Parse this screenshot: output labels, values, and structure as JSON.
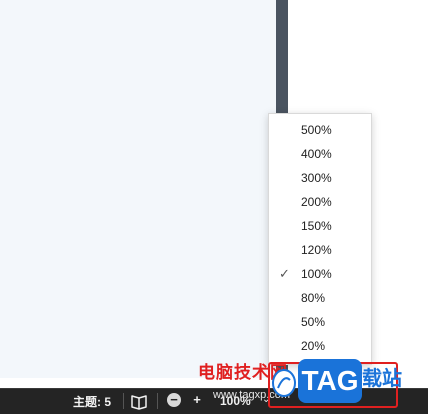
{
  "statusbar": {
    "topics_label": "主题: 5",
    "zoom_value": "100%",
    "zoom_minus": "−",
    "zoom_plus": "+",
    "zoom_caret": "⌄"
  },
  "zoom_menu": {
    "selected": "100%",
    "options": [
      "500%",
      "400%",
      "300%",
      "200%",
      "150%",
      "120%",
      "100%",
      "80%",
      "50%",
      "20%"
    ]
  },
  "watermark": {
    "site_name": "电脑技术网",
    "url": "www.tagxp.com",
    "tag": "TAG",
    "suffix": "载站"
  },
  "colors": {
    "statusbar_bg": "#242424",
    "canvas_bg": "#f3f7fb",
    "watermark_red": "#e02020",
    "watermark_blue": "#1a73d9"
  }
}
